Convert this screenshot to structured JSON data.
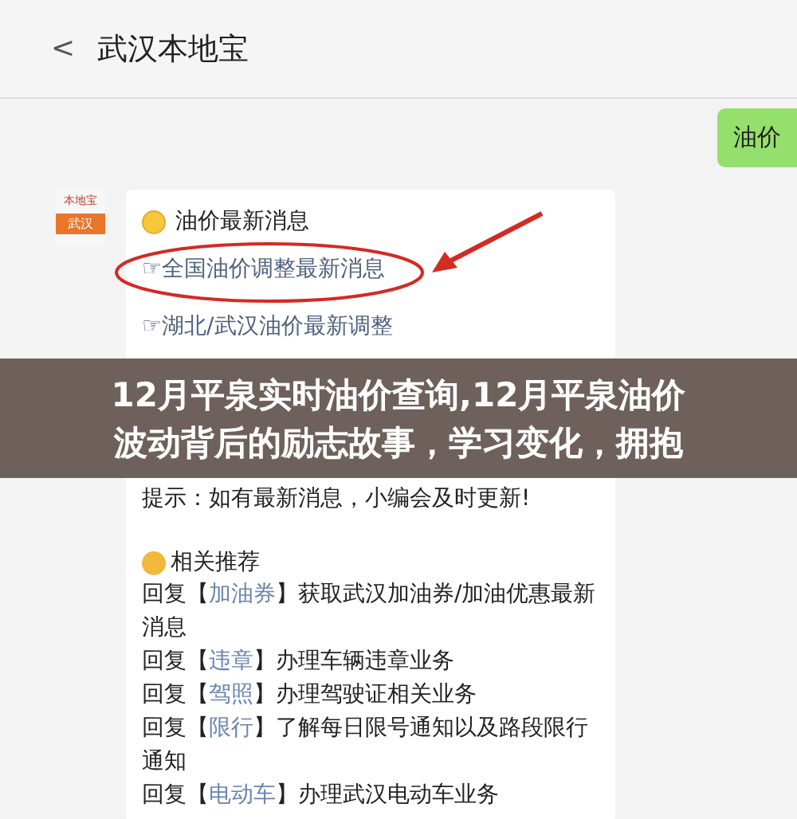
{
  "header": {
    "back": "<",
    "title": "武汉本地宝"
  },
  "sent_message": {
    "text": "油价"
  },
  "avatar": {
    "brand": "本地宝",
    "city": "武汉"
  },
  "card": {
    "heading": "油价最新消息",
    "links": [
      {
        "text": "☞全国油价调整最新消息"
      },
      {
        "text": "☞湖北/武汉油价最新调整"
      }
    ],
    "tip": "提示：如有最新消息，小编会及时更新!",
    "recommend_heading": "相关推荐",
    "replies": [
      {
        "prefix": "回复【",
        "keyword": "加油券",
        "suffix": "】获取武汉加油券/加油优惠最新消息"
      },
      {
        "prefix": "回复【",
        "keyword": "违章",
        "suffix": "】办理车辆违章业务"
      },
      {
        "prefix": "回复【",
        "keyword": "驾照",
        "suffix": "】办理驾驶证相关业务"
      },
      {
        "prefix": "回复【",
        "keyword": "限行",
        "suffix": "】了解每日限号通知以及路段限行通知"
      },
      {
        "prefix": "回复【",
        "keyword": "电动车",
        "suffix": "】办理武汉电动车业务"
      }
    ]
  },
  "banner": {
    "lines": [
      "12月平泉实时油价查询,12月平泉油价",
      "波动背后的励志故事，学习变化，拥抱"
    ]
  }
}
